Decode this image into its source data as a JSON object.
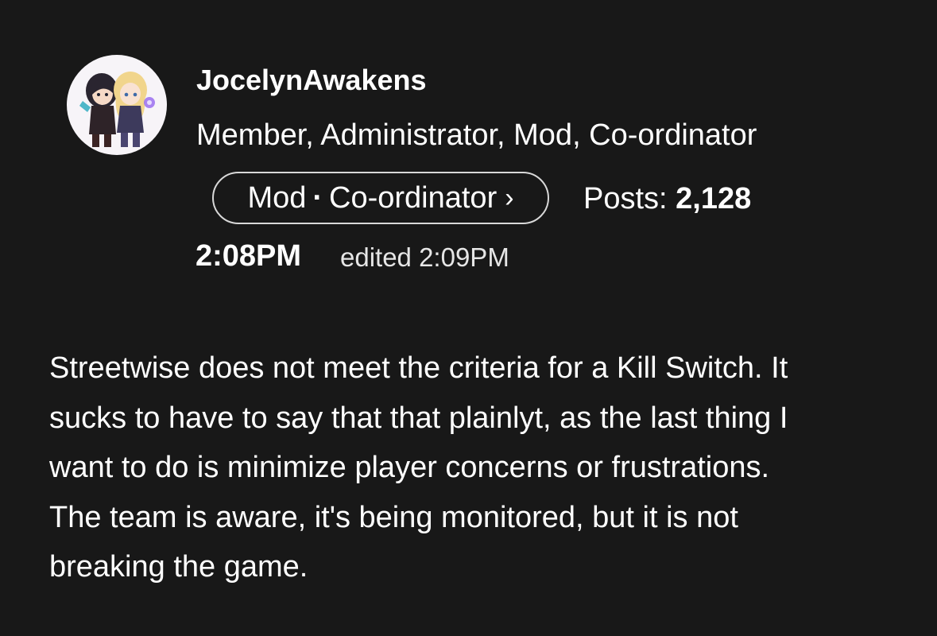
{
  "author": {
    "username": "JocelynAwakens",
    "roles": "Member, Administrator, Mod, Co-ordinator",
    "avatar_icon": "avatar-illustration"
  },
  "role_badge": {
    "primary": "Mod",
    "separator": "·",
    "secondary": "Co-ordinator",
    "chevron": "›"
  },
  "posts": {
    "label": "Posts:",
    "count": "2,128"
  },
  "timestamp": {
    "time": "2:08PM",
    "edited": "edited 2:09PM"
  },
  "body": {
    "lines": [
      "Streetwise does not meet the criteria for a Kill Switch. It",
      "sucks to have to say that that plainlyt, as the last thing I",
      "want to do is minimize player concerns or frustrations.",
      "The team is aware, it's being monitored, but it is not",
      "breaking the game."
    ]
  },
  "colors": {
    "background": "#181818",
    "text": "#ffffff",
    "pill_border": "#d8d8d8"
  }
}
